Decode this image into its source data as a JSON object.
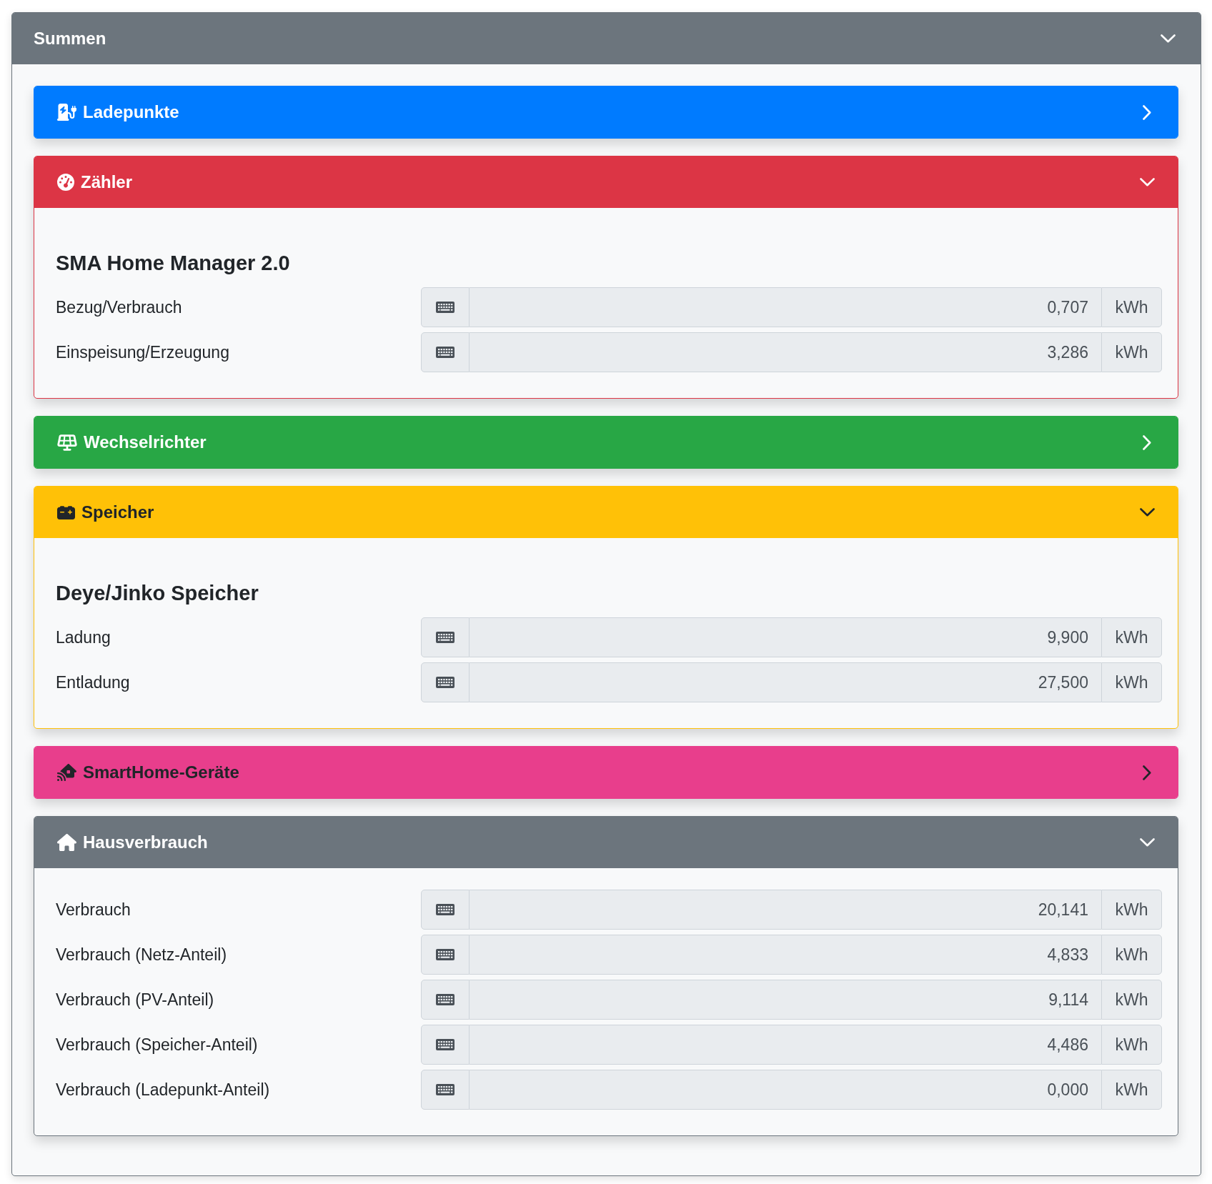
{
  "panel": {
    "title": "Summen",
    "expanded": true
  },
  "sections": [
    {
      "kind": "chargepoints",
      "title": "Ladepunkte",
      "color": "#007bff",
      "expanded": false
    },
    {
      "kind": "meter",
      "title": "Zähler",
      "color": "#dc3545",
      "expanded": true,
      "heading": "SMA Home Manager 2.0",
      "rows": [
        {
          "label": "Bezug/Verbrauch",
          "value": "0,707",
          "unit": "kWh"
        },
        {
          "label": "Einspeisung/Erzeugung",
          "value": "3,286",
          "unit": "kWh"
        }
      ]
    },
    {
      "kind": "inverter",
      "title": "Wechselrichter",
      "color": "#28a745",
      "expanded": false
    },
    {
      "kind": "battery",
      "title": "Speicher",
      "color": "#ffc107",
      "expanded": true,
      "heading": "Deye/Jinko Speicher",
      "rows": [
        {
          "label": "Ladung",
          "value": "9,900",
          "unit": "kWh"
        },
        {
          "label": "Entladung",
          "value": "27,500",
          "unit": "kWh"
        }
      ]
    },
    {
      "kind": "smarthome",
      "title": "SmartHome-Geräte",
      "color": "#e83e8c",
      "expanded": false
    },
    {
      "kind": "house",
      "title": "Hausverbrauch",
      "color": "#6c757d",
      "expanded": true,
      "rows": [
        {
          "label": "Verbrauch",
          "value": "20,141",
          "unit": "kWh"
        },
        {
          "label": "Verbrauch (Netz-Anteil)",
          "value": "4,833",
          "unit": "kWh"
        },
        {
          "label": "Verbrauch (PV-Anteil)",
          "value": "9,114",
          "unit": "kWh"
        },
        {
          "label": "Verbrauch (Speicher-Anteil)",
          "value": "4,486",
          "unit": "kWh"
        },
        {
          "label": "Verbrauch (Ladepunkt-Anteil)",
          "value": "0,000",
          "unit": "kWh"
        }
      ]
    }
  ]
}
